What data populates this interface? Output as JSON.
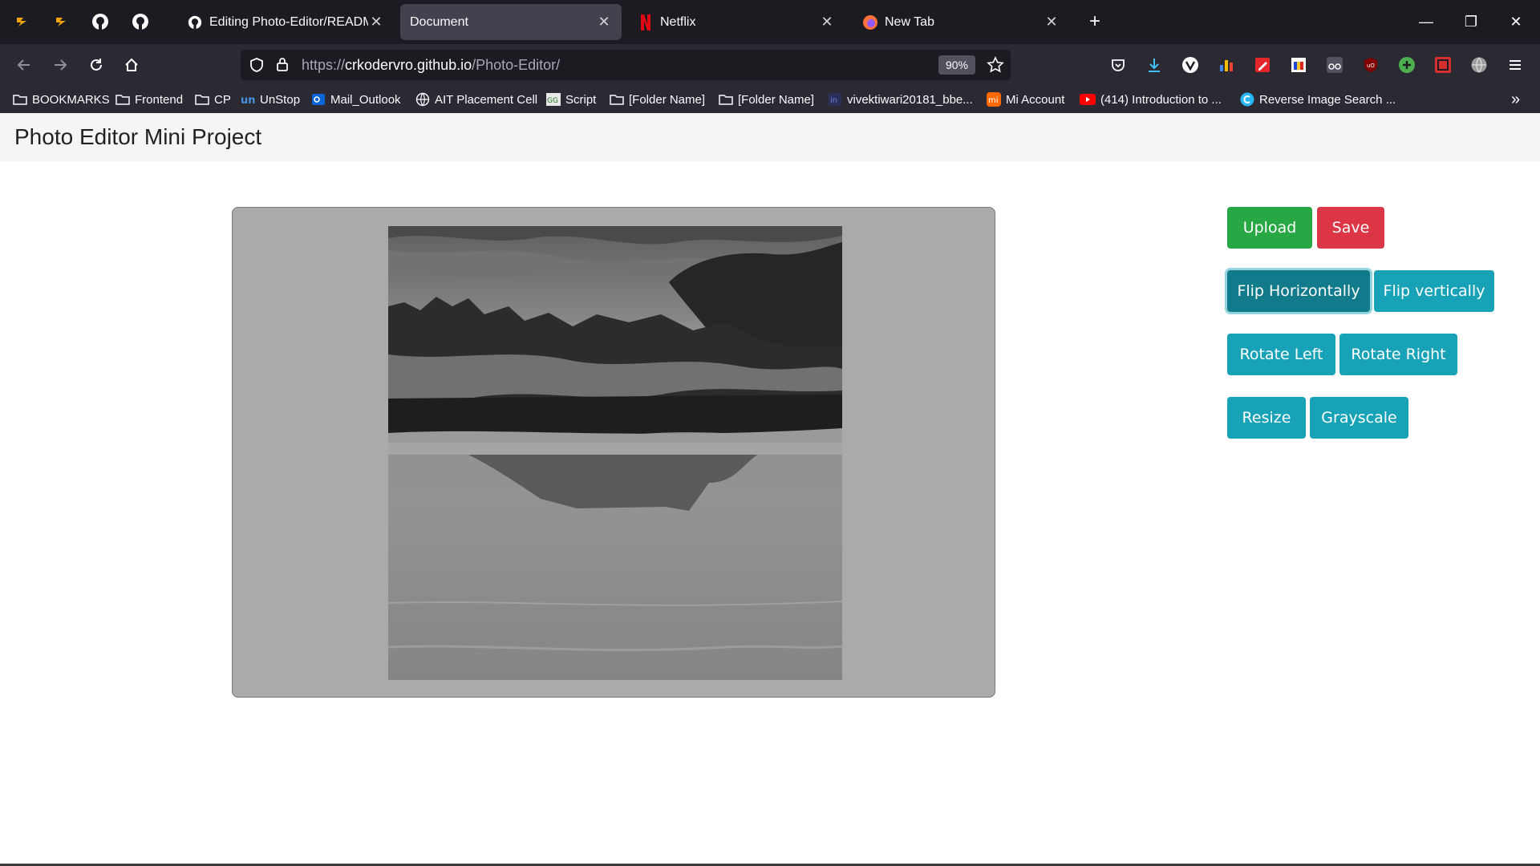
{
  "browser": {
    "tabs": [
      {
        "title": "Editing Photo-Editor/README.md",
        "icon": "github-icon",
        "active": false
      },
      {
        "title": "Document",
        "icon": "",
        "active": true
      },
      {
        "title": "Netflix",
        "icon": "netflix-icon",
        "active": false
      },
      {
        "title": "New Tab",
        "icon": "firefox-icon",
        "active": false
      }
    ],
    "url_scheme": "https://",
    "url_host": "crkodervro.github.io",
    "url_path": "/Photo-Editor/",
    "zoom": "90%",
    "bookmarks": [
      {
        "label": "BOOKMARKS",
        "icon": "folder-icon"
      },
      {
        "label": "Frontend",
        "icon": "folder-icon"
      },
      {
        "label": "CP",
        "icon": "folder-icon"
      },
      {
        "label": "UnStop",
        "icon": "unstop-icon"
      },
      {
        "label": "Mail_Outlook",
        "icon": "outlook-icon"
      },
      {
        "label": "AIT Placement Cell",
        "icon": "globe-icon"
      },
      {
        "label": "Script",
        "icon": "script-icon"
      },
      {
        "label": "[Folder Name]",
        "icon": "folder-icon"
      },
      {
        "label": "[Folder Name]",
        "icon": "folder-icon"
      },
      {
        "label": "vivektiwari20181_bbe...",
        "icon": "page-icon"
      },
      {
        "label": "Mi Account",
        "icon": "mi-icon"
      },
      {
        "label": "(414) Introduction to ...",
        "icon": "youtube-icon"
      },
      {
        "label": "Reverse Image Search ...",
        "icon": "reverse-search-icon"
      }
    ]
  },
  "page": {
    "title": "Photo Editor Mini Project"
  },
  "controls": {
    "upload": "Upload",
    "save": "Save",
    "flip_horizontal": "Flip Horizontally",
    "flip_vertical": "Flip vertically",
    "rotate_left": "Rotate Left",
    "rotate_right": "Rotate Right",
    "resize": "Resize",
    "grayscale": "Grayscale"
  },
  "colors": {
    "success": "#28a745",
    "danger": "#dc3545",
    "info": "#17a2b8",
    "info_active": "#117a8b"
  }
}
